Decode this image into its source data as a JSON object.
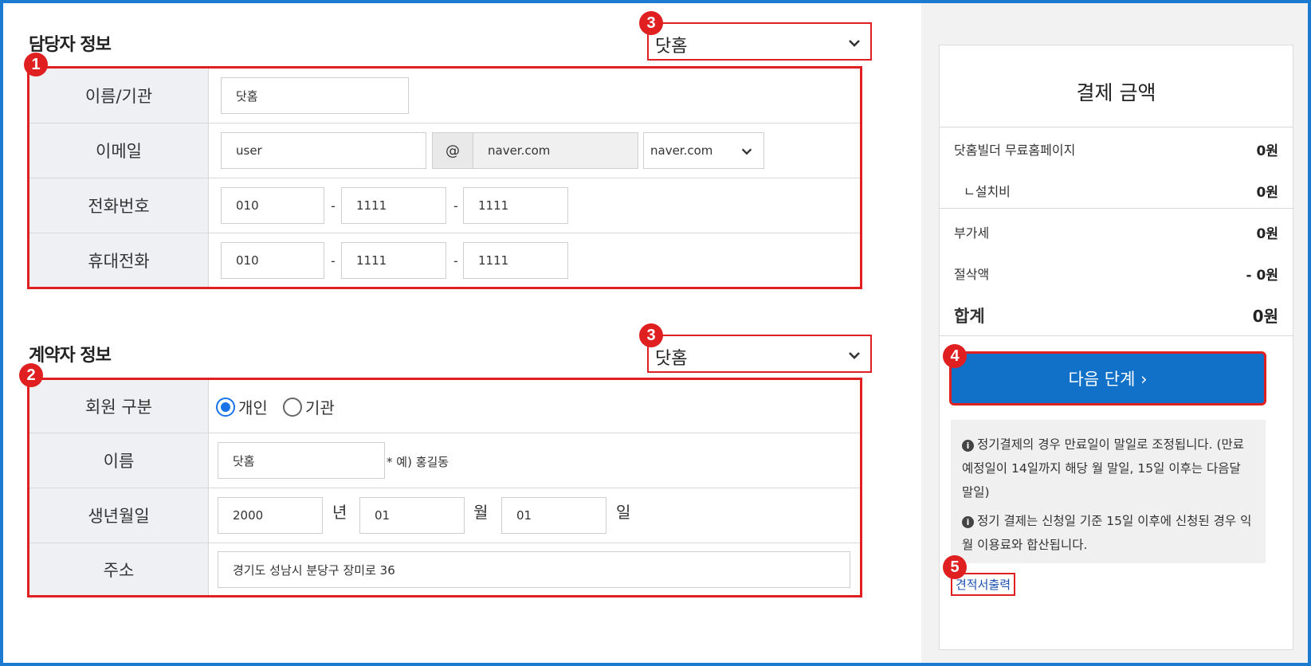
{
  "manager_section": {
    "title": "담당자 정보",
    "select_value": "닷홈",
    "select_badge": "3",
    "form_badge": "1",
    "rows": {
      "name_label": "이름/기관",
      "name_value": "닷홈",
      "email_label": "이메일",
      "email_user": "user",
      "email_at": "@",
      "email_domain": "naver.com",
      "email_select": "naver.com",
      "phone_label": "전화번호",
      "phone": [
        "010",
        "1111",
        "1111"
      ],
      "mobile_label": "휴대전화",
      "mobile": [
        "010",
        "1111",
        "1111"
      ],
      "dash": "-"
    }
  },
  "contract_section": {
    "title": "계약자 정보",
    "select_value": "닷홈",
    "select_badge": "3",
    "form_badge": "2",
    "rows": {
      "member_label": "회원 구분",
      "radio_personal": "개인",
      "radio_org": "기관",
      "name_label": "이름",
      "name_value": "닷홈",
      "name_hint": "* 예) 홍길동",
      "birth_label": "생년월일",
      "birth_year": "2000",
      "birth_year_unit": "년",
      "birth_month": "01",
      "birth_month_unit": "월",
      "birth_day": "01",
      "birth_day_unit": "일",
      "address_label": "주소",
      "address_value": "경기도 성남시 분당구 장미로 36"
    }
  },
  "payment": {
    "title": "결제 금액",
    "items": [
      {
        "label": "닷홈빌더 무료홈페이지",
        "amount": "0원"
      },
      {
        "label": "ㄴ설치비",
        "amount": "0원"
      },
      {
        "label": "부가세",
        "amount": "0원"
      },
      {
        "label": "절삭액",
        "amount": "- 0원"
      }
    ],
    "total_label": "합계",
    "total_amount": "0원",
    "next_button": "다음 단계 ›",
    "next_badge": "4",
    "notice_1": "정기결제의 경우 만료일이 말일로 조정됩니다. (만료예정일이 14일까지 해당 월 말일, 15일 이후는 다음달 말일)",
    "notice_2": "정기 결제는 신청일 기준 15일 이후에 신청된 경우 익월 이용료와 합산됩니다.",
    "estimate_link": "견적서출력",
    "estimate_badge": "5"
  },
  "colors": {
    "accent_blue": "#1170c8",
    "annotation_red": "#e02020",
    "frame_blue": "#1a7bd0"
  }
}
